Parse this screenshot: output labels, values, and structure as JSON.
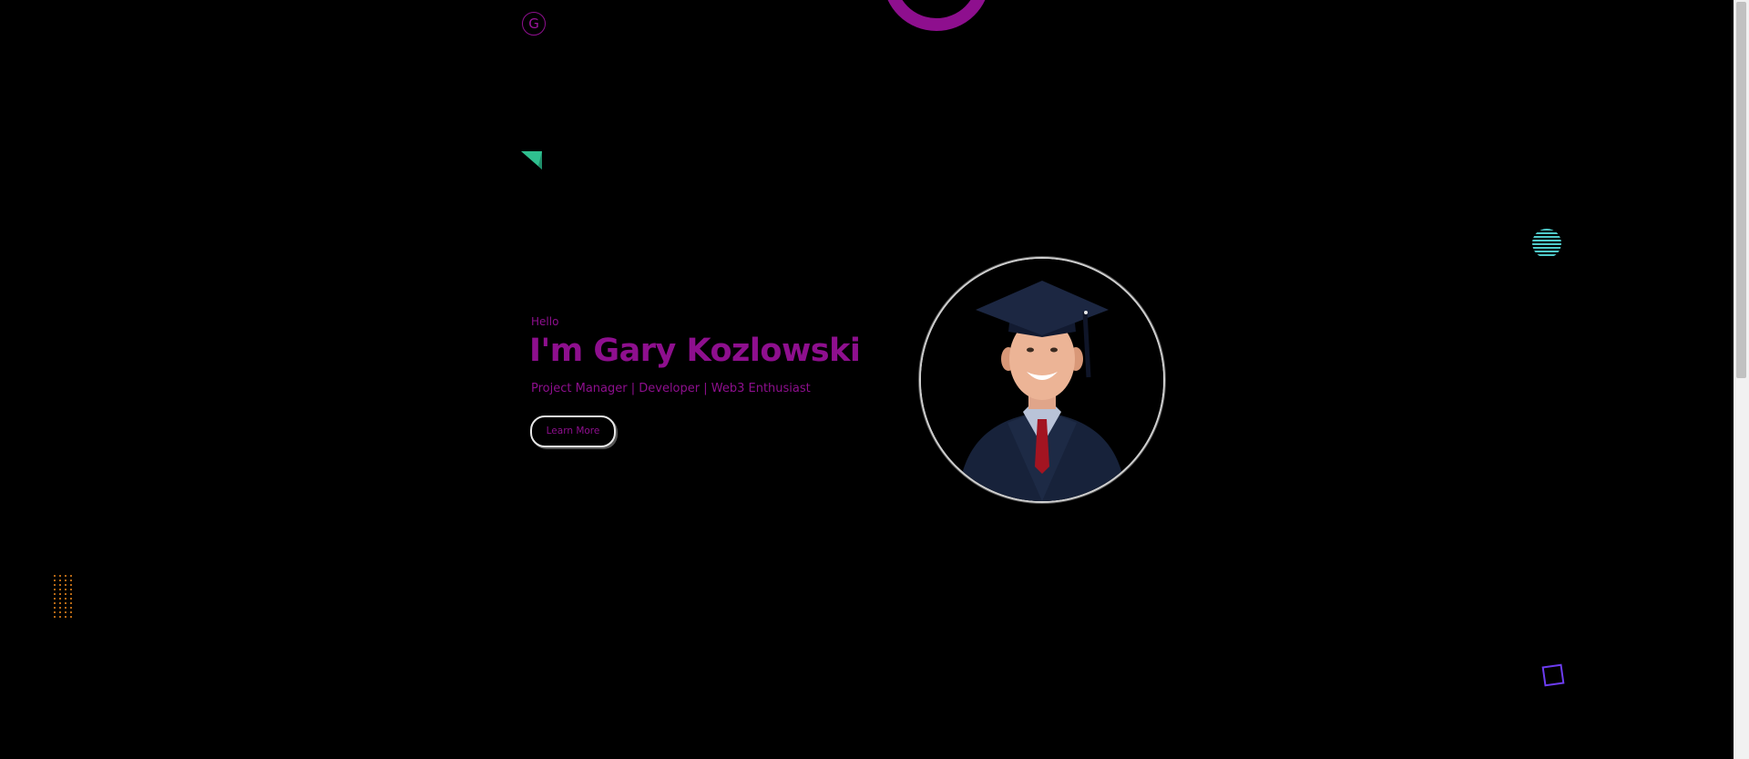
{
  "header": {
    "logo_letter": "G"
  },
  "hero": {
    "greeting": "Hello",
    "name": "I'm Gary Kozlowski",
    "tagline": "Project Manager | Developer | Web3 Enthusiast",
    "cta_label": "Learn More"
  },
  "colors": {
    "background": "#000000",
    "accent": "#8e0f8e",
    "triangle": "#2fbf8f",
    "striped_ball": "#4fc9c9",
    "dots": "#f08a1c",
    "square": "#6c3cf0"
  },
  "icons": {
    "logo": "g-logo-icon",
    "top_ring": "ring-shape-icon",
    "triangle": "triangle-shape-icon",
    "striped_ball": "striped-circle-icon",
    "dot_grid": "dot-grid-icon",
    "square": "square-outline-icon"
  }
}
